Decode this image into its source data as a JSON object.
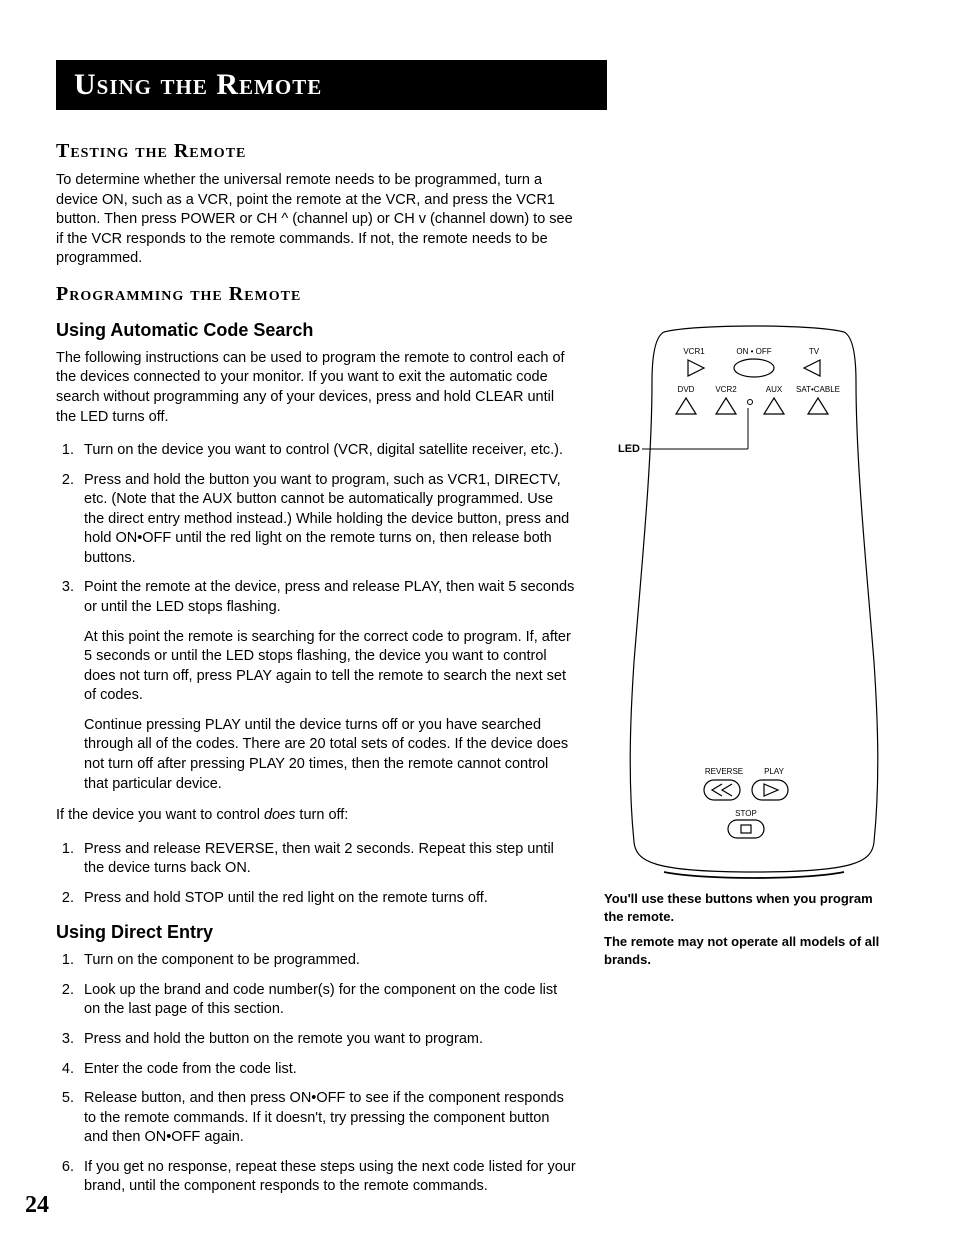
{
  "page_number": "24",
  "title": "Using the Remote",
  "sections": {
    "testing": {
      "heading": "Testing the Remote",
      "body": "To determine whether the universal remote needs to be programmed, turn a device ON, such as a VCR, point the remote at the VCR, and press the VCR1 button. Then press POWER or CH ^ (channel up) or CH v (channel down) to see if the VCR responds to the remote commands. If not, the remote needs to be programmed."
    },
    "programming": {
      "heading": "Programming the Remote",
      "auto": {
        "heading": "Using Automatic Code Search",
        "intro": "The following instructions can be used to program the remote to control each of the devices connected to your monitor. If you want to exit the automatic code search without programming any of your devices, press and hold CLEAR until the LED turns off.",
        "steps": [
          "Turn on the device you want to control (VCR, digital satellite receiver, etc.).",
          "Press and hold the button you want to program, such as VCR1, DIRECTV, etc. (Note that the AUX button cannot be automatically programmed. Use the direct entry method instead.) While holding the device button, press and hold ON•OFF until the red light on the remote turns on, then release both buttons.",
          "Point the remote at the device, press and release PLAY, then wait 5 seconds or until the LED stops flashing."
        ],
        "step3_extra1": "At this point the remote is searching for the correct code to program. If, after 5 seconds or until the LED stops flashing, the device you want to control does not turn off, press PLAY again to tell the remote to search the next set of codes.",
        "step3_extra2": "Continue pressing PLAY until the device turns off or you have searched through all of the codes. There are 20 total sets of codes. If the device does not turn off after pressing PLAY 20 times, then the remote cannot control that particular device.",
        "if_off_intro_pre": "If the device you want to control ",
        "if_off_intro_em": "does",
        "if_off_intro_post": " turn off:",
        "if_off_steps": [
          "Press and release REVERSE, then wait 2 seconds. Repeat this step until the device turns back ON.",
          "Press and hold STOP until the red light on the remote turns off."
        ]
      },
      "direct": {
        "heading": "Using Direct Entry",
        "steps": [
          "Turn on the component to be programmed.",
          "Look up the brand and code number(s) for the component on the code list on the last page of this section.",
          "Press and hold the button on the remote you want to program.",
          "Enter the code from the code list.",
          "Release button, and then press ON•OFF to see if the component responds to the remote commands. If it doesn't, try pressing the component button and then ON•OFF again.",
          "If you get no response, repeat these steps using the next code listed for your brand, until the component responds to the remote commands."
        ]
      }
    }
  },
  "figure": {
    "led_label": "LED",
    "button_labels": {
      "vcr1": "VCR1",
      "onoff": "ON • OFF",
      "tv": "TV",
      "dvd": "DVD",
      "vcr2": "VCR2",
      "aux": "AUX",
      "satcable": "SAT•CABLE",
      "reverse": "REVERSE",
      "play": "PLAY",
      "stop": "STOP"
    },
    "caption1": "You'll use these buttons when you program the remote.",
    "caption2": "The remote may not operate all models of all brands."
  }
}
